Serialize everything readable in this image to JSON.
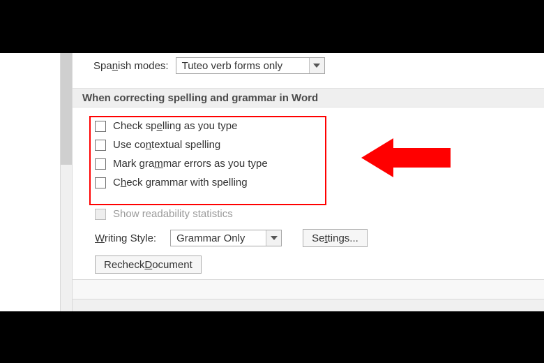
{
  "spanish": {
    "label_pre": "Spa",
    "label_mnem": "n",
    "label_post": "ish modes:",
    "value": "Tuteo verb forms only"
  },
  "section": {
    "title": "When correcting spelling and grammar in Word"
  },
  "checks": {
    "spelling_pre": "Check sp",
    "spelling_mnem": "e",
    "spelling_post": "lling as you type",
    "contextual_pre": "Use co",
    "contextual_mnem": "n",
    "contextual_post": "textual spelling",
    "grammar_pre": "Mark gra",
    "grammar_mnem": "m",
    "grammar_post": "mar errors as you type",
    "withspell_pre": "C",
    "withspell_mnem": "h",
    "withspell_post": "eck grammar with spelling"
  },
  "readability": {
    "label": "Show readability statistics"
  },
  "writing": {
    "label_mnem": "W",
    "label_post": "riting Style:",
    "value": "Grammar Only"
  },
  "buttons": {
    "settings_pre": "Se",
    "settings_mnem": "t",
    "settings_post": "tings...",
    "recheck_pre": "Recheck ",
    "recheck_mnem": "D",
    "recheck_post": "ocument"
  },
  "colors": {
    "highlight": "#ff0000"
  }
}
